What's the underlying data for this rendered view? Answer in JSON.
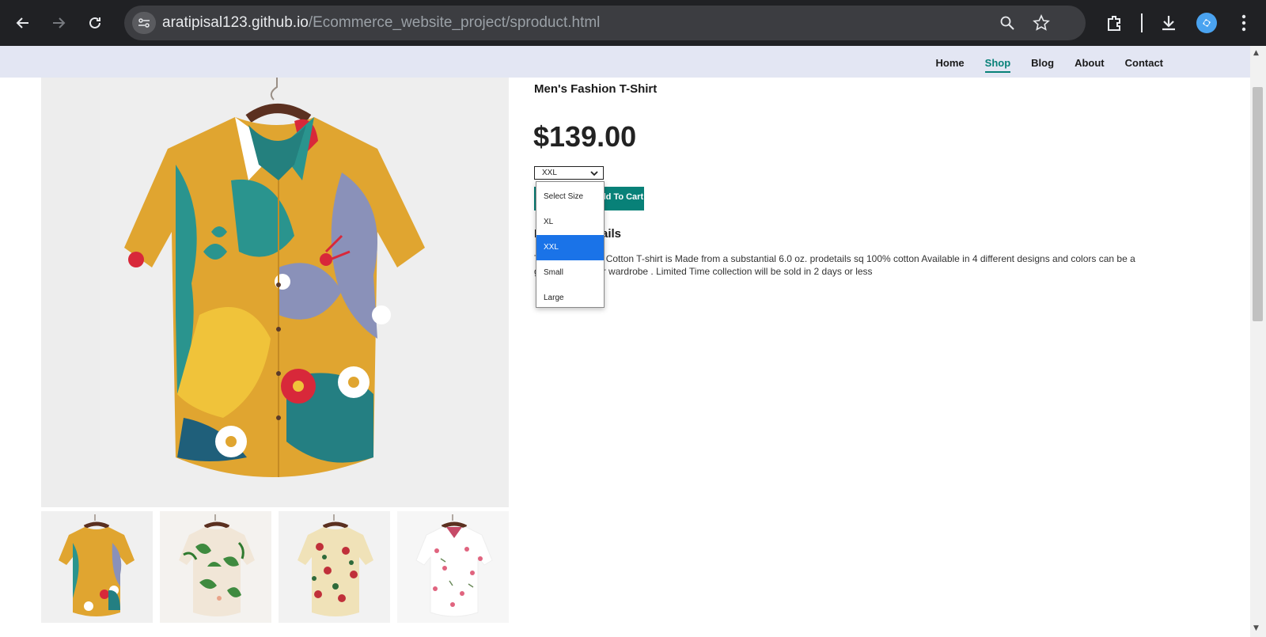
{
  "browser": {
    "url_domain": "aratipisal123.github.io",
    "url_path": "/Ecommerce_website_project/sproduct.html",
    "icons": [
      "back-icon",
      "forward-icon",
      "reload-icon",
      "site-info-icon",
      "zoom-icon",
      "bookmark-star-icon",
      "extensions-icon",
      "download-icon",
      "profile-avatar",
      "menu-icon"
    ]
  },
  "nav": {
    "items": [
      {
        "label": "Home",
        "active": false
      },
      {
        "label": "Shop",
        "active": true
      },
      {
        "label": "Blog",
        "active": false
      },
      {
        "label": "About",
        "active": false
      },
      {
        "label": "Contact",
        "active": false
      }
    ]
  },
  "product": {
    "title": "Men's Fashion T-Shirt",
    "price": "$139.00",
    "selected_size": "XXL",
    "cart_label": "Add To Cart",
    "details_heading": "Product Details",
    "details_text": "The Gildan Ultra Cotton T-shirt is Made from a substantial 6.0 oz. prodetails sq 100% cotton Available in 4 different designs and colors can be a great add to your wardrobe . Limited Time collection will be sold in 2 days or less"
  },
  "size_options": [
    "Select Size",
    "XL",
    "XXL",
    "Small",
    "Large"
  ],
  "colors": {
    "accent": "#088178",
    "navbar_bg": "#e3e6f3",
    "selected_option": "#1a73e8",
    "chrome_bg": "#202124"
  },
  "gallery": {
    "thumbnails": [
      "multicolor-leaf-shirt",
      "green-palm-shirt",
      "red-floral-shirt",
      "white-pink-floral-shirt"
    ]
  }
}
